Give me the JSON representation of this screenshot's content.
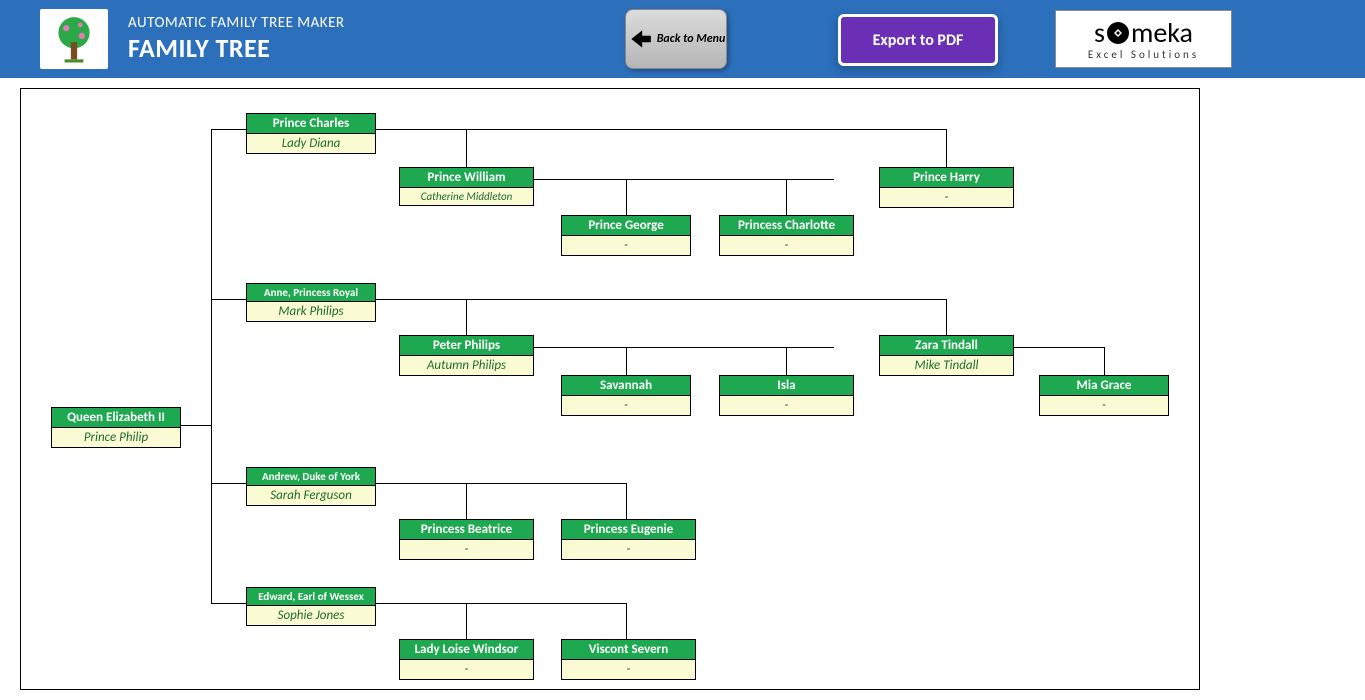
{
  "header": {
    "subtitle": "AUTOMATIC FAMILY TREE MAKER",
    "title": "FAMILY TREE",
    "back_label": "Back to Menu",
    "export_label": "Export to PDF",
    "brand_main": "someka",
    "brand_sub": "Excel Solutions"
  },
  "nodes": {
    "root": {
      "name": "Queen Elizabeth II",
      "spouse": "Prince Philip"
    },
    "charles": {
      "name": "Prince Charles",
      "spouse": "Lady Diana"
    },
    "william": {
      "name": "Prince William",
      "spouse": "Catherine Middleton"
    },
    "george": {
      "name": "Prince George",
      "spouse": "-"
    },
    "charlotte": {
      "name": "Princess Charlotte",
      "spouse": "-"
    },
    "harry": {
      "name": "Prince Harry",
      "spouse": "-"
    },
    "anne": {
      "name": "Anne, Princess Royal",
      "spouse": "Mark Philips"
    },
    "peter": {
      "name": "Peter Philips",
      "spouse": "Autumn Philips"
    },
    "savannah": {
      "name": "Savannah",
      "spouse": "-"
    },
    "isla": {
      "name": "Isla",
      "spouse": "-"
    },
    "zara": {
      "name": "Zara Tindall",
      "spouse": "Mike Tindall"
    },
    "mia": {
      "name": "Mia Grace",
      "spouse": "-"
    },
    "andrew": {
      "name": "Andrew, Duke of York",
      "spouse": "Sarah Ferguson"
    },
    "beatrice": {
      "name": "Princess Beatrice",
      "spouse": "-"
    },
    "eugenie": {
      "name": "Princess Eugenie",
      "spouse": "-"
    },
    "edward": {
      "name": "Edward, Earl of Wessex",
      "spouse": "Sophie Jones"
    },
    "loise": {
      "name": "Lady Loise Windsor",
      "spouse": "-"
    },
    "severn": {
      "name": "Viscont Severn",
      "spouse": "-"
    }
  }
}
